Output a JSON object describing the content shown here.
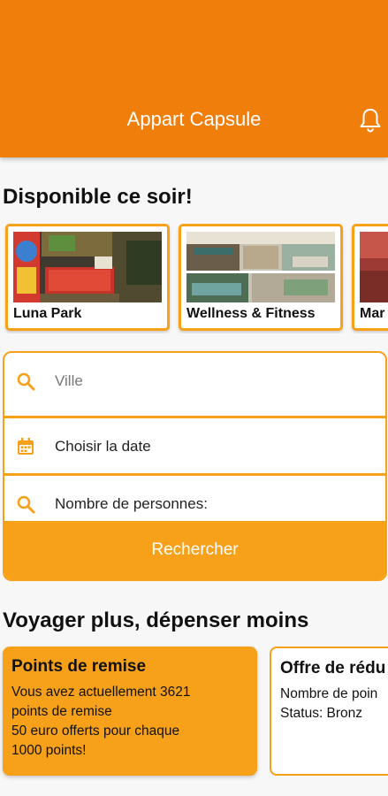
{
  "app_bar": {
    "title": "Appart Capsule",
    "bell_icon": "bell-icon"
  },
  "tonight": {
    "title": "Disponible ce soir!",
    "cards": [
      {
        "label": "Luna Park"
      },
      {
        "label": "Wellness & Fitness"
      },
      {
        "label": "Mar"
      }
    ]
  },
  "search": {
    "city_placeholder": "Ville",
    "date_label": "Choisir la date",
    "people_label": "Nombre de personnes:",
    "button_label": "Rechercher"
  },
  "travel": {
    "title": "Voyager plus, dépenser moins",
    "points_card": {
      "title": "Points de remise",
      "lines": [
        "Vous avez actuellement 3621",
        "points de remise",
        "50 euro offerts pour chaque",
        "1000 points!"
      ]
    },
    "offer_card": {
      "title": "Offre de rédu",
      "lines": [
        "Nombre de poin",
        "Status: Bronz"
      ]
    }
  },
  "colors": {
    "primary": "#f07e0b",
    "accent": "#f7a11a"
  }
}
